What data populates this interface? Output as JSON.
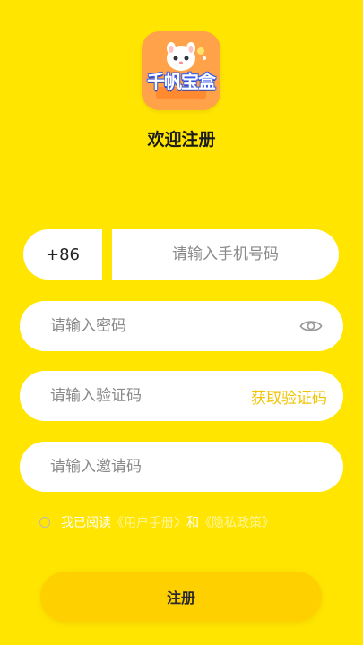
{
  "app": {
    "logo_text": "千帆宝盒",
    "title": "欢迎注册"
  },
  "form": {
    "country_code": "+86",
    "phone_placeholder": "请输入手机号码",
    "password_placeholder": "请输入密码",
    "password_toggle_icon": "eye-icon",
    "code_placeholder": "请输入验证码",
    "get_code_label": "获取验证码",
    "invite_placeholder": "请输入邀请码"
  },
  "agreement": {
    "prefix": "我已阅读",
    "user_manual": "《用户手册》",
    "and": "和",
    "privacy_policy": "《隐私政策》",
    "checked": false
  },
  "submit": {
    "label": "注册"
  },
  "colors": {
    "background": "#FFE500",
    "accent": "#F2C300",
    "button": "#FFD000"
  }
}
